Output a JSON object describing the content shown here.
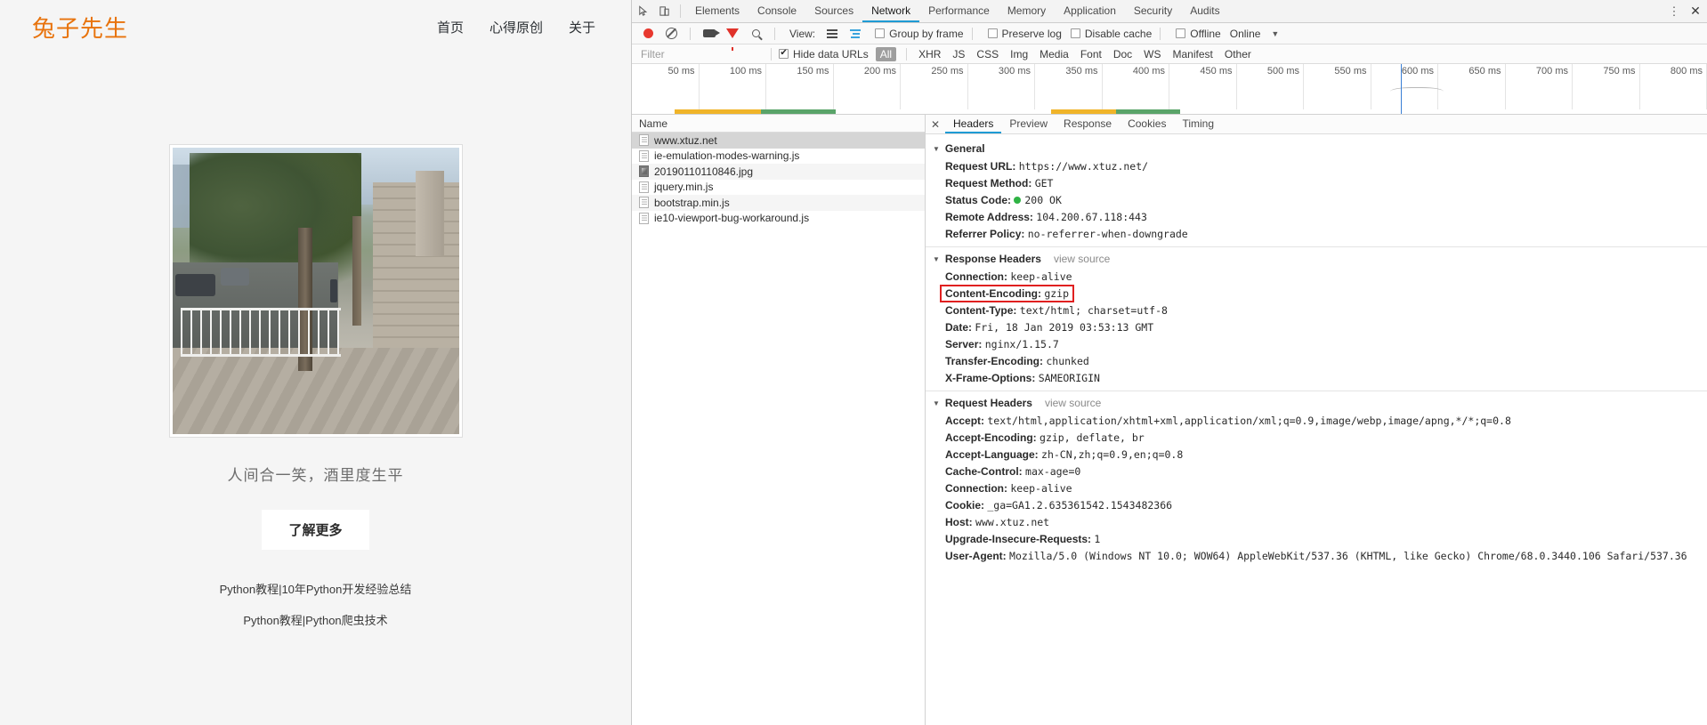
{
  "page": {
    "brand": "兔子先生",
    "nav": [
      {
        "label": "首页"
      },
      {
        "label": "心得原创"
      },
      {
        "label": "关于"
      }
    ],
    "caption": "人间合一笑，酒里度生平",
    "learn_more": "了解更多",
    "links": [
      {
        "label": "Python教程|10年Python开发经验总结"
      },
      {
        "label": "Python教程|Python爬虫技术"
      }
    ],
    "brand_color": "#e8730c"
  },
  "devtools": {
    "tabs": [
      {
        "label": "Elements",
        "active": false
      },
      {
        "label": "Console",
        "active": false
      },
      {
        "label": "Sources",
        "active": false
      },
      {
        "label": "Network",
        "active": true
      },
      {
        "label": "Performance",
        "active": false
      },
      {
        "label": "Memory",
        "active": false
      },
      {
        "label": "Application",
        "active": false
      },
      {
        "label": "Security",
        "active": false
      },
      {
        "label": "Audits",
        "active": false
      }
    ],
    "accent_color": "#1f9bd4",
    "toolbar": {
      "view_label": "View:",
      "group_by_frame": "Group by frame",
      "preserve_log": "Preserve log",
      "disable_cache": "Disable cache",
      "offline": "Offline",
      "online": "Online",
      "record_state": "recording"
    },
    "filterbar": {
      "filter_placeholder": "Filter",
      "filter_value": "",
      "hide_data_urls": "Hide data URLs",
      "hide_data_urls_checked": true,
      "types": [
        {
          "label": "All",
          "active": true
        },
        {
          "label": "XHR",
          "active": false
        },
        {
          "label": "JS",
          "active": false
        },
        {
          "label": "CSS",
          "active": false
        },
        {
          "label": "Img",
          "active": false
        },
        {
          "label": "Media",
          "active": false
        },
        {
          "label": "Font",
          "active": false
        },
        {
          "label": "Doc",
          "active": false
        },
        {
          "label": "WS",
          "active": false
        },
        {
          "label": "Manifest",
          "active": false
        },
        {
          "label": "Other",
          "active": false
        }
      ]
    },
    "overview_ticks": [
      "50 ms",
      "100 ms",
      "150 ms",
      "200 ms",
      "250 ms",
      "300 ms",
      "350 ms",
      "400 ms",
      "450 ms",
      "500 ms",
      "550 ms",
      "600 ms",
      "650 ms",
      "700 ms",
      "750 ms",
      "800 ms"
    ],
    "requests": {
      "column_name": "Name",
      "rows": [
        {
          "name": "www.xtuz.net",
          "icon": "document-icon",
          "selected": true
        },
        {
          "name": "ie-emulation-modes-warning.js",
          "icon": "document-icon",
          "selected": false
        },
        {
          "name": "20190110110846.jpg",
          "icon": "image-icon",
          "selected": false
        },
        {
          "name": "jquery.min.js",
          "icon": "document-icon",
          "selected": false
        },
        {
          "name": "bootstrap.min.js",
          "icon": "document-icon",
          "selected": false
        },
        {
          "name": "ie10-viewport-bug-workaround.js",
          "icon": "document-icon",
          "selected": false
        }
      ]
    },
    "detail": {
      "tabs": [
        {
          "label": "Headers",
          "active": true
        },
        {
          "label": "Preview",
          "active": false
        },
        {
          "label": "Response",
          "active": false
        },
        {
          "label": "Cookies",
          "active": false
        },
        {
          "label": "Timing",
          "active": false
        }
      ],
      "general": {
        "title": "General",
        "rows": [
          {
            "key": "Request URL:",
            "value": "https://www.xtuz.net/"
          },
          {
            "key": "Request Method:",
            "value": "GET"
          },
          {
            "key": "Status Code:",
            "value": "200 OK",
            "status": true
          },
          {
            "key": "Remote Address:",
            "value": "104.200.67.118:443"
          },
          {
            "key": "Referrer Policy:",
            "value": "no-referrer-when-downgrade"
          }
        ]
      },
      "response_headers": {
        "title": "Response Headers",
        "view_source": "view source",
        "rows": [
          {
            "key": "Connection:",
            "value": "keep-alive"
          },
          {
            "key": "Content-Encoding:",
            "value": "gzip",
            "highlight": true
          },
          {
            "key": "Content-Type:",
            "value": "text/html; charset=utf-8"
          },
          {
            "key": "Date:",
            "value": "Fri, 18 Jan 2019 03:53:13 GMT"
          },
          {
            "key": "Server:",
            "value": "nginx/1.15.7"
          },
          {
            "key": "Transfer-Encoding:",
            "value": "chunked"
          },
          {
            "key": "X-Frame-Options:",
            "value": "SAMEORIGIN"
          }
        ]
      },
      "request_headers": {
        "title": "Request Headers",
        "view_source": "view source",
        "rows": [
          {
            "key": "Accept:",
            "value": "text/html,application/xhtml+xml,application/xml;q=0.9,image/webp,image/apng,*/*;q=0.8"
          },
          {
            "key": "Accept-Encoding:",
            "value": "gzip, deflate, br"
          },
          {
            "key": "Accept-Language:",
            "value": "zh-CN,zh;q=0.9,en;q=0.8"
          },
          {
            "key": "Cache-Control:",
            "value": "max-age=0"
          },
          {
            "key": "Connection:",
            "value": "keep-alive"
          },
          {
            "key": "Cookie:",
            "value": "_ga=GA1.2.635361542.1543482366"
          },
          {
            "key": "Host:",
            "value": "www.xtuz.net"
          },
          {
            "key": "Upgrade-Insecure-Requests:",
            "value": "1"
          },
          {
            "key": "User-Agent:",
            "value": "Mozilla/5.0 (Windows NT 10.0; WOW64) AppleWebKit/537.36 (KHTML, like Gecko) Chrome/68.0.3440.106 Safari/537.36"
          }
        ]
      },
      "highlight_color": "#e02020"
    }
  }
}
